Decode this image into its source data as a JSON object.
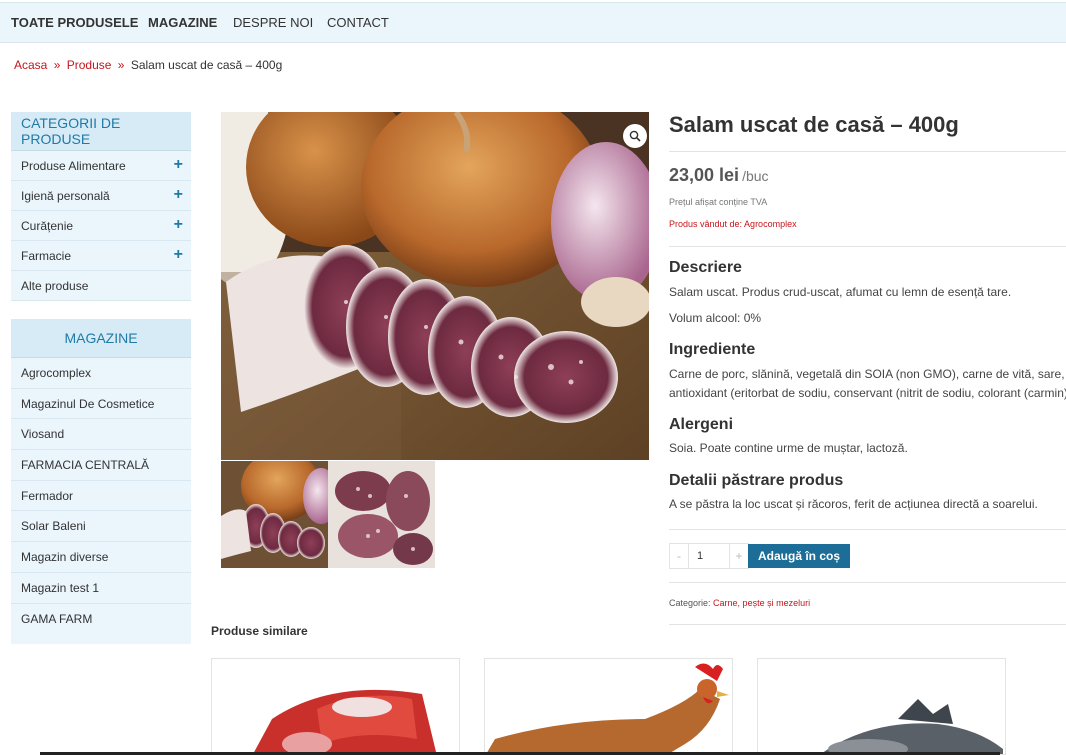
{
  "nav": {
    "items": [
      {
        "label": "TOATE PRODUSELE"
      },
      {
        "label": "MAGAZINE"
      },
      {
        "label": "DESPRE NOI"
      },
      {
        "label": "CONTACT"
      }
    ]
  },
  "breadcrumb": {
    "home": "Acasa",
    "separator": "»",
    "products": "Produse",
    "current": "Salam uscat de casă – 400g"
  },
  "categories": {
    "title": "CATEGORII DE PRODUSE",
    "items": [
      {
        "label": "Produse Alimentare",
        "expand": "+"
      },
      {
        "label": "Igienă personală",
        "expand": "+"
      },
      {
        "label": "Curățenie",
        "expand": "+"
      },
      {
        "label": "Farmacie",
        "expand": "+"
      },
      {
        "label": "Alte produse"
      }
    ]
  },
  "stores": {
    "title": "MAGAZINE",
    "items": [
      {
        "label": "Agrocomplex"
      },
      {
        "label": "Magazinul De Cosmetice"
      },
      {
        "label": "Viosand"
      },
      {
        "label": "FARMACIA CENTRALĂ"
      },
      {
        "label": "Fermador"
      },
      {
        "label": "Solar Baleni"
      },
      {
        "label": "Magazin diverse"
      },
      {
        "label": "Magazin test 1"
      },
      {
        "label": "GAMA FARM"
      }
    ]
  },
  "product": {
    "title": "Salam uscat de casă – 400g",
    "price": "23,00 lei",
    "price_unit": "/buc",
    "tva_note": "Prețul afișat conține TVA",
    "sold_by": "Produs vândut de: Agrocomplex",
    "description_title": "Descriere",
    "description_line1": "Salam uscat. Produs crud-uscat, afumat cu lemn de esență tare.",
    "description_line2": "Volum alcool: 0%",
    "ingredients_title": "Ingrediente",
    "ingredients_line1": "Carne de porc, slănină, vegetală din SOIA (non GMO), carne de vită, sare,",
    "ingredients_line2": "antioxidant (eritorbat de sodiu, conservant (nitrit de sodiu, colorant (carmin)",
    "allergens_title": "Alergeni",
    "allergens_text": "Soia. Poate contine urme de muștar, lactoză.",
    "storage_title": "Detalii păstrare produs",
    "storage_text": "A se păstra la loc uscat și răcoros, ferit de acțiunea directă a soarelui.",
    "qty_minus": "-",
    "qty_value": "1",
    "qty_plus": "+",
    "add_to_cart": "Adaugă în coș",
    "category_label": "Categorie:",
    "category_value": "Carne, pește și mezeluri"
  },
  "related": {
    "title": "Produse similare"
  },
  "colors": {
    "accent": "#1f7aa6",
    "button": "#1c6e98",
    "link_red": "#c4161c",
    "sidebar_bg": "#eaf5fc"
  },
  "icons": {
    "zoom": "magnifier-icon",
    "expand": "plus-icon"
  }
}
